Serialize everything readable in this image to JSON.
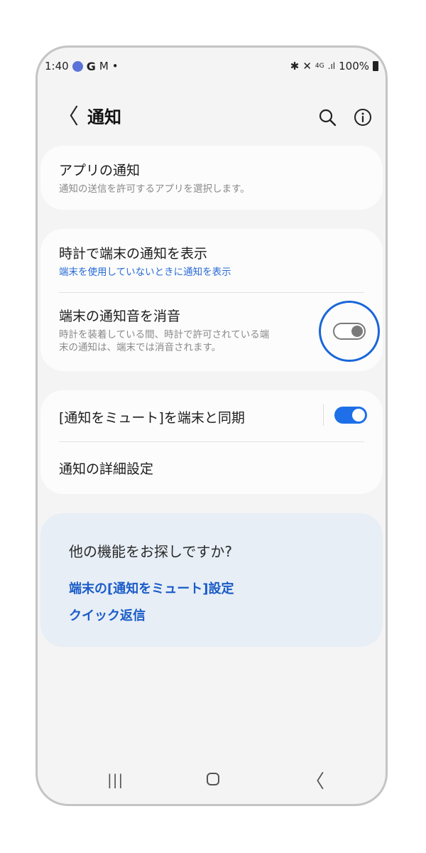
{
  "status_bar": {
    "time": "1:40",
    "wear_label": "Wear",
    "g_label": "G",
    "gmail_label": "M",
    "dot": "•",
    "signal_label": "4G",
    "battery": "100%"
  },
  "header": {
    "title": "通知",
    "back_glyph": "〈",
    "search_icon": "search-icon",
    "info_icon": "info-icon"
  },
  "app_notifications": {
    "title": "アプリの通知",
    "subtitle": "通知の送信を許可するアプリを選択します。"
  },
  "watch_section": {
    "show_on_watch": {
      "title": "時計で端末の通知を表示",
      "subtitle": "端末を使用していないときに通知を表示"
    },
    "mute_sound": {
      "title": "端末の通知音を消音",
      "subtitle_line1": "時計を装着している間、時計で許可されている端",
      "subtitle_line2": "末の通知は、端末では消音されます。",
      "enabled": false
    }
  },
  "sync_section": {
    "sync_mute": {
      "title": "[通知をミュート]を端末と同期",
      "enabled": true
    },
    "advanced": {
      "title": "通知の詳細設定"
    }
  },
  "promo": {
    "title": "他の機能をお探しですか?",
    "links": [
      "端末の[通知をミュート]設定",
      "クイック返信"
    ]
  },
  "nav": {
    "recent": "|||",
    "back": "〈"
  },
  "colors": {
    "accent": "#1e6fe8",
    "link": "#1a5cc8",
    "highlight_ring": "#1a66d9",
    "promo_bg": "#e7eef6"
  }
}
